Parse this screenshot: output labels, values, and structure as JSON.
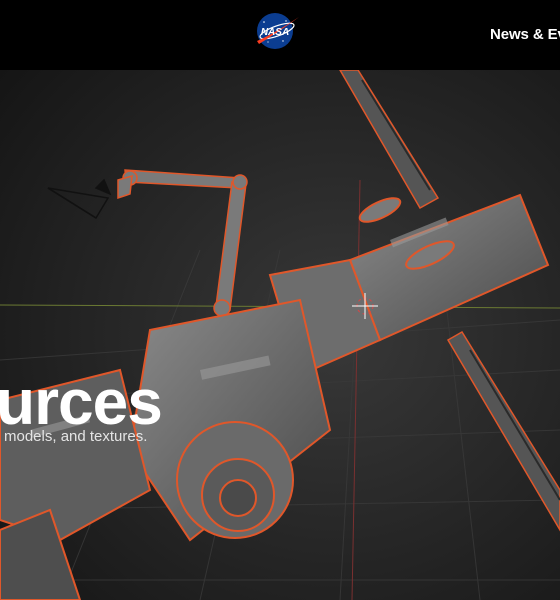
{
  "header": {
    "logo_text": "NASA",
    "nav": [
      {
        "label": "News & Ev"
      }
    ]
  },
  "hero": {
    "title": "urces",
    "subtitle": "models, and textures."
  },
  "colors": {
    "background": "#2a2a2a",
    "topbar": "#000000",
    "outline": "#e0572a",
    "nasa_blue": "#0b3d91",
    "nasa_red": "#fc3d21"
  }
}
